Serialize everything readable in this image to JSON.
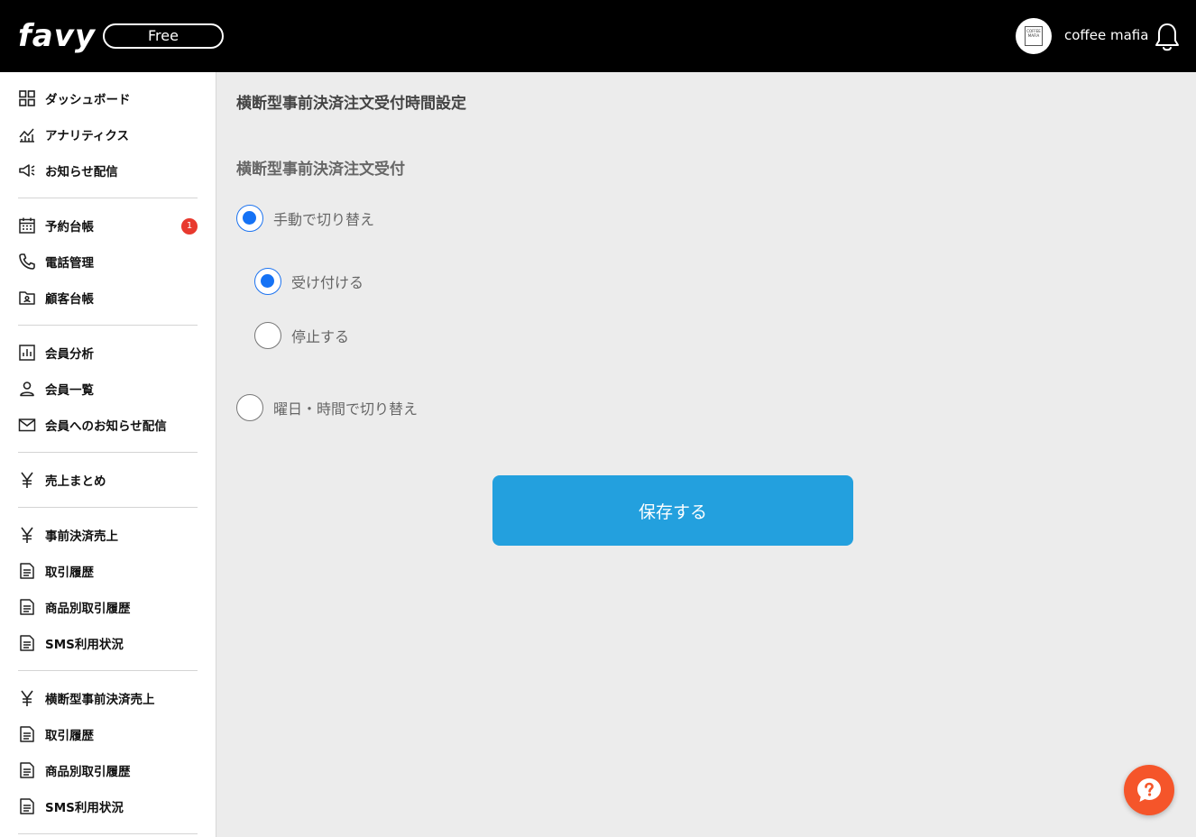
{
  "header": {
    "logo": "favy",
    "plan_badge": "Free",
    "avatar_text": "COFFEE MAFIA",
    "account_name": "coffee mafia"
  },
  "sidebar": {
    "groups": [
      [
        {
          "label": "ダッシュボード",
          "icon": "dashboard-grid-icon"
        },
        {
          "label": "アナリティクス",
          "icon": "analytics-chart-icon"
        },
        {
          "label": "お知らせ配信",
          "icon": "megaphone-icon"
        }
      ],
      [
        {
          "label": "予約台帳",
          "icon": "calendar-icon",
          "badge": "1"
        },
        {
          "label": "電話管理",
          "icon": "phone-icon"
        },
        {
          "label": "顧客台帳",
          "icon": "customer-folder-icon"
        }
      ],
      [
        {
          "label": "会員分析",
          "icon": "bar-chart-icon"
        },
        {
          "label": "会員一覧",
          "icon": "person-icon"
        },
        {
          "label": "会員へのお知らせ配信",
          "icon": "mail-icon"
        }
      ],
      [
        {
          "label": "売上まとめ",
          "icon": "yen-icon"
        }
      ],
      [
        {
          "label": "事前決済売上",
          "icon": "yen-icon"
        },
        {
          "label": "取引履歴",
          "icon": "document-icon"
        },
        {
          "label": "商品別取引履歴",
          "icon": "document-icon"
        },
        {
          "label": "SMS利用状況",
          "icon": "document-icon"
        }
      ],
      [
        {
          "label": "横断型事前決済売上",
          "icon": "yen-icon"
        },
        {
          "label": "取引履歴",
          "icon": "document-icon"
        },
        {
          "label": "商品別取引履歴",
          "icon": "document-icon"
        },
        {
          "label": "SMS利用状況",
          "icon": "document-icon"
        }
      ]
    ]
  },
  "main": {
    "page_title": "横断型事前決済注文受付時間設定",
    "section_title": "横断型事前決済注文受付",
    "mode_options": [
      {
        "label": "手動で切り替え",
        "checked": true
      },
      {
        "label": "曜日・時間で切り替え",
        "checked": false
      }
    ],
    "manual_options": [
      {
        "label": "受け付ける",
        "checked": true
      },
      {
        "label": "停止する",
        "checked": false
      }
    ],
    "save_label": "保存する"
  },
  "colors": {
    "header_bg": "#000000",
    "accent_radio": "#1572f5",
    "save_button": "#23a0de",
    "help_button": "#f5552a",
    "badge": "#e8392e"
  }
}
